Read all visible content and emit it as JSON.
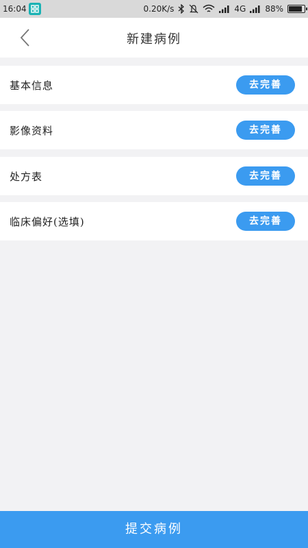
{
  "status_bar": {
    "time": "16:04",
    "speed": "0.20K/s",
    "network": "4G",
    "battery": "88%",
    "battery_level": 0.88
  },
  "header": {
    "title": "新建病例",
    "back_icon": "chevron-left-icon"
  },
  "rows": [
    {
      "label": "基本信息",
      "button": "去完善"
    },
    {
      "label": "影像资料",
      "button": "去完善"
    },
    {
      "label": "处方表",
      "button": "去完善"
    },
    {
      "label": "临床偏好(选填)",
      "button": "去完善"
    }
  ],
  "submit_label": "提交病例",
  "colors": {
    "accent": "#3b9bf0",
    "background": "#f2f2f4",
    "status_bar": "#d9d9d9"
  }
}
